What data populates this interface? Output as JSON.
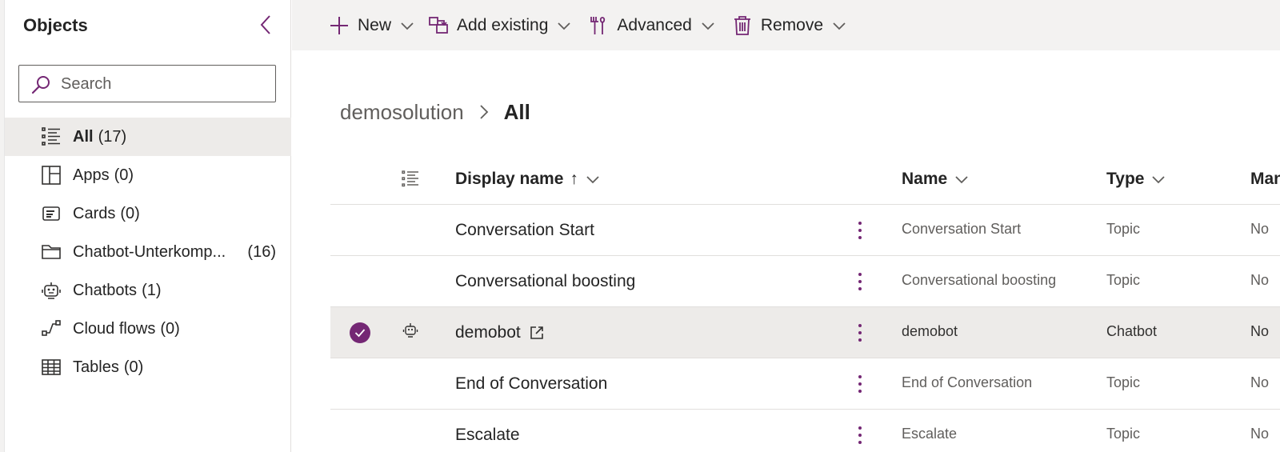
{
  "sidebar": {
    "title": "Objects",
    "search_placeholder": "Search",
    "items": [
      {
        "label": "All",
        "count": "(17)",
        "icon": "list-icon",
        "active": true
      },
      {
        "label": "Apps",
        "count": "(0)",
        "icon": "apps-icon"
      },
      {
        "label": "Cards",
        "count": "(0)",
        "icon": "card-icon"
      },
      {
        "label": "Chatbot-Unterkomp...",
        "count": "(16)",
        "icon": "folder-icon"
      },
      {
        "label": "Chatbots",
        "count": "(1)",
        "icon": "bot-icon"
      },
      {
        "label": "Cloud flows",
        "count": "(0)",
        "icon": "flow-icon"
      },
      {
        "label": "Tables",
        "count": "(0)",
        "icon": "table-icon"
      }
    ]
  },
  "toolbar": {
    "new_label": "New",
    "add_existing_label": "Add existing",
    "advanced_label": "Advanced",
    "remove_label": "Remove"
  },
  "breadcrumb": {
    "parent": "demosolution",
    "current": "All"
  },
  "grid": {
    "columns": {
      "display_name": "Display name",
      "sort_arrow": "↑",
      "name": "Name",
      "type": "Type",
      "managed": "Man"
    },
    "rows": [
      {
        "display_name": "Conversation Start",
        "name": "Conversation Start",
        "type": "Topic",
        "managed": "No"
      },
      {
        "display_name": "Conversational boosting",
        "name": "Conversational boosting",
        "type": "Topic",
        "managed": "No"
      },
      {
        "display_name": "demobot",
        "name": "demobot",
        "type": "Chatbot",
        "managed": "No",
        "selected": true
      },
      {
        "display_name": "End of Conversation",
        "name": "End of Conversation",
        "type": "Topic",
        "managed": "No"
      },
      {
        "display_name": "Escalate",
        "name": "Escalate",
        "type": "Topic",
        "managed": "No"
      }
    ]
  },
  "colors": {
    "accent": "#742774",
    "selected_row": "#edebe9",
    "toolbar_bg": "#f3f2f1"
  }
}
